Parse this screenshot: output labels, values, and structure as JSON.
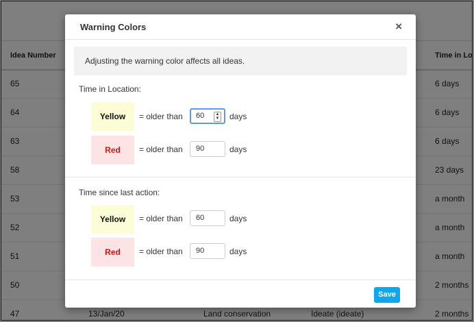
{
  "table": {
    "headers": {
      "idea_number": "Idea Number",
      "time_in_location": "Time in Loc"
    },
    "rows": [
      {
        "idea": "65",
        "time": "6 days"
      },
      {
        "idea": "64",
        "time": "6 days"
      },
      {
        "idea": "63",
        "time": "6 days"
      },
      {
        "idea": "58",
        "time": "23 days"
      },
      {
        "idea": "53",
        "time": "a month"
      },
      {
        "idea": "52",
        "time": "a month"
      },
      {
        "idea": "51",
        "time": "a month"
      },
      {
        "idea": "50",
        "time": "2 months"
      },
      {
        "idea": "47",
        "date": "13/Jan/20",
        "name": "Land conservation",
        "stage": "Ideate (ideate)",
        "time": "2 months"
      }
    ]
  },
  "modal": {
    "title": "Warning Colors",
    "close_label": "×",
    "info": "Adjusting the warning color affects all ideas.",
    "sections": [
      {
        "label": "Time in Location:",
        "yellow": {
          "label": "Yellow",
          "prefix": "= older than",
          "value": "60",
          "suffix": "days"
        },
        "red": {
          "label": "Red",
          "prefix": "= older than",
          "value": "90",
          "suffix": "days"
        }
      },
      {
        "label": "Time since last action:",
        "yellow": {
          "label": "Yellow",
          "prefix": "= older than",
          "value": "60",
          "suffix": "days"
        },
        "red": {
          "label": "Red",
          "prefix": "= older than",
          "value": "90",
          "suffix": "days"
        }
      }
    ],
    "save_label": "Save"
  },
  "colors": {
    "yellow_bg": "#fcfcd6",
    "red_bg": "#fde4e4",
    "red_text": "#d41515",
    "accent": "#0fa6ec"
  }
}
